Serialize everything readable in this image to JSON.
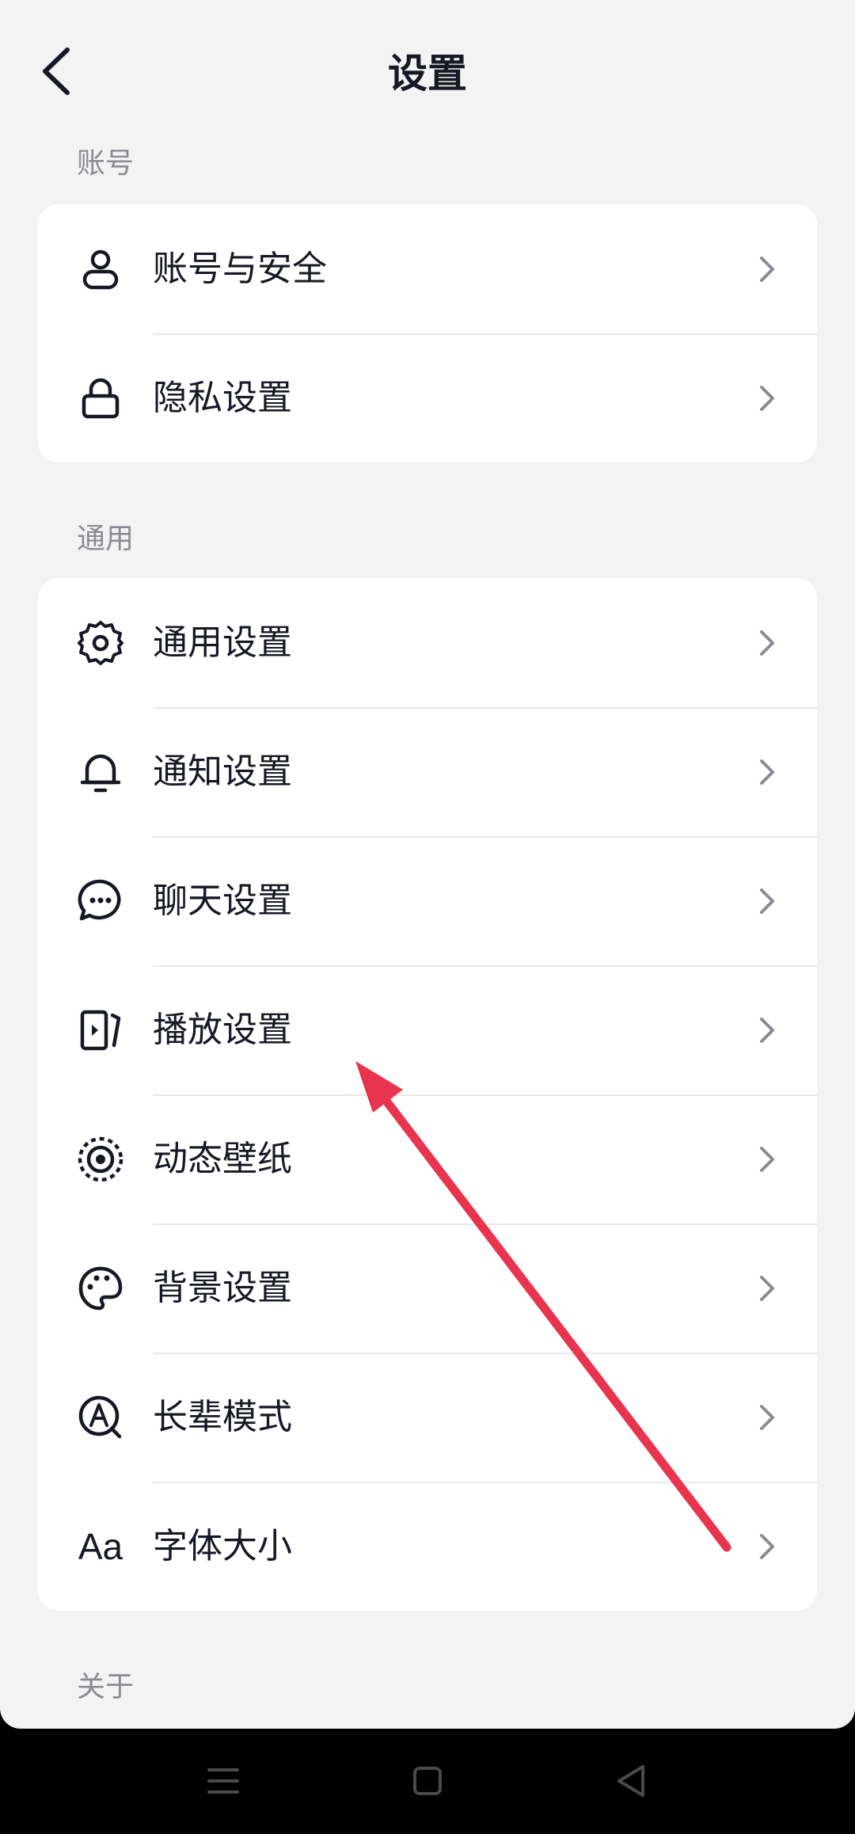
{
  "header": {
    "title": "设置"
  },
  "sections": [
    {
      "label": "账号",
      "items": [
        {
          "label": "账号与安全",
          "icon": "user-icon"
        },
        {
          "label": "隐私设置",
          "icon": "lock-icon"
        }
      ]
    },
    {
      "label": "通用",
      "items": [
        {
          "label": "通用设置",
          "icon": "gear-icon"
        },
        {
          "label": "通知设置",
          "icon": "bell-icon"
        },
        {
          "label": "聊天设置",
          "icon": "chat-bubble-icon"
        },
        {
          "label": "播放设置",
          "icon": "play-panel-icon"
        },
        {
          "label": "动态壁纸",
          "icon": "wallpaper-icon"
        },
        {
          "label": "背景设置",
          "icon": "palette-icon"
        },
        {
          "label": "长辈模式",
          "icon": "elder-mode-icon"
        },
        {
          "label": "字体大小",
          "icon": "font-size-icon",
          "icon_text": "Aa"
        }
      ]
    },
    {
      "label": "关于",
      "items": []
    }
  ],
  "colors": {
    "background": "#f3f3f4",
    "card": "#ffffff",
    "text": "#161823",
    "section_label": "#8a8b91",
    "chevron": "#8a8b91",
    "arrow_annotation": "#e8344e"
  },
  "navbar": {
    "buttons": [
      "menu-icon",
      "home-square-icon",
      "back-triangle-icon"
    ]
  }
}
